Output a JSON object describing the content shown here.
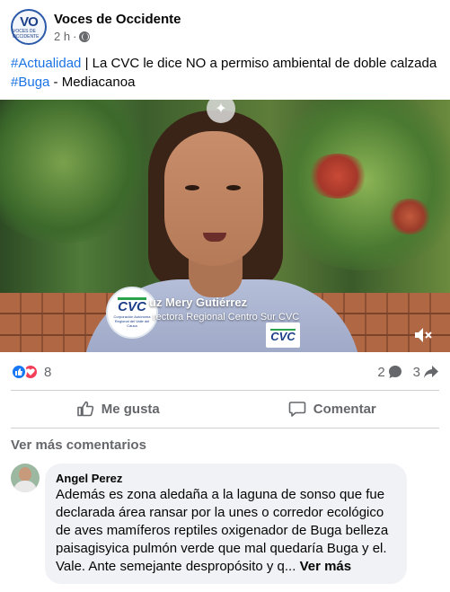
{
  "post": {
    "page_name": "Voces de Occidente",
    "avatar_text": "VO",
    "avatar_subtext": "VOCES DE OCCIDENTE",
    "time": "2 h",
    "separator": "·",
    "privacy_icon": "globe-icon",
    "hashtag1": "#Actualidad",
    "text1": " | La CVC le dice NO a permiso ambiental de doble calzada ",
    "hashtag2": "#Buga",
    "text2": " - Mediacanoa"
  },
  "video": {
    "overlay_icon": "sparkle-icon",
    "logo_text": "CVC",
    "logo_subtext": "Corporación Autónoma Regional del Valle del Cauca",
    "name_text": "uz Mery Gutiérrez",
    "title_text": "rectora Regional Centro Sur CVC",
    "shirt_logo": "CVC",
    "mute_icon": "speaker-muted-icon"
  },
  "reactions": {
    "count": "8",
    "comments": "2",
    "shares": "3"
  },
  "actions": {
    "like": "Me gusta",
    "comment": "Comentar"
  },
  "comments_section": {
    "more_label": "Ver más comentarios",
    "author": "Angel Perez",
    "text": "Además es zona aledaña a la laguna de sonso que fue declarada área ransar por la unes o corredor ecológico de aves mamíferos reptiles oxigenador de Buga belleza paisagisyica pulmón verde que mal quedaría Buga y el. Vale. Ante semejante despropósito y q...",
    "see_more": "Ver más"
  },
  "colors": {
    "link": "#1b74e4",
    "like": "#1877f2",
    "love": "#f33e58",
    "muted_text": "#65676b",
    "bubble": "#f0f2f5"
  }
}
